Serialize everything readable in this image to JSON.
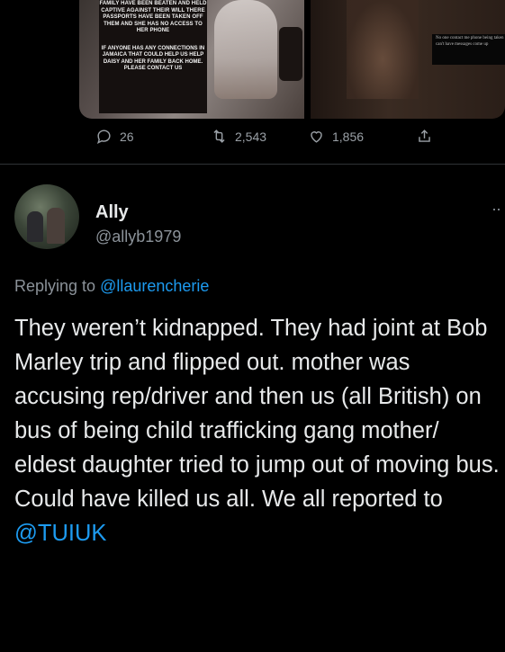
{
  "media": {
    "poster_text_top": "FAMILY HAVE BEEN BEATEN AND HELD CAPTIVE AGAINST THEIR WILL THERE PASSPORTS HAVE BEEN TAKEN OFF THEM AND SHE HAS NO ACCESS TO HER PHONE",
    "poster_text_bottom": "IF ANYONE HAS ANY CONNECTIONS IN JAMAICA THAT COULD HELP US HELP DAISY AND HER FAMILY BACK HOME. PLEASE CONTACT US",
    "phone_text": "No one contact me phone being taken can't have messages come up"
  },
  "actions": {
    "reply_count": "26",
    "retweet_count": "2,543",
    "like_count": "1,856"
  },
  "reply": {
    "display_name": "Ally",
    "handle": "@allyb1979",
    "more_label": "··",
    "replying_prefix": "Replying to ",
    "replying_to": "@llaurencherie",
    "text": "They weren’t kidnapped. They had joint at Bob Marley trip and flipped out. mother was accusing rep/driver and then us (all British) on bus of being child trafficking gang mother/ eldest daughter tried to jump out of moving bus. Could have killed us all. We all reported to ",
    "text_mention": "@TUIUK"
  },
  "colors": {
    "background": "#000000",
    "text": "#e7e9ea",
    "muted": "#8b9299",
    "link": "#1d9bf0"
  }
}
